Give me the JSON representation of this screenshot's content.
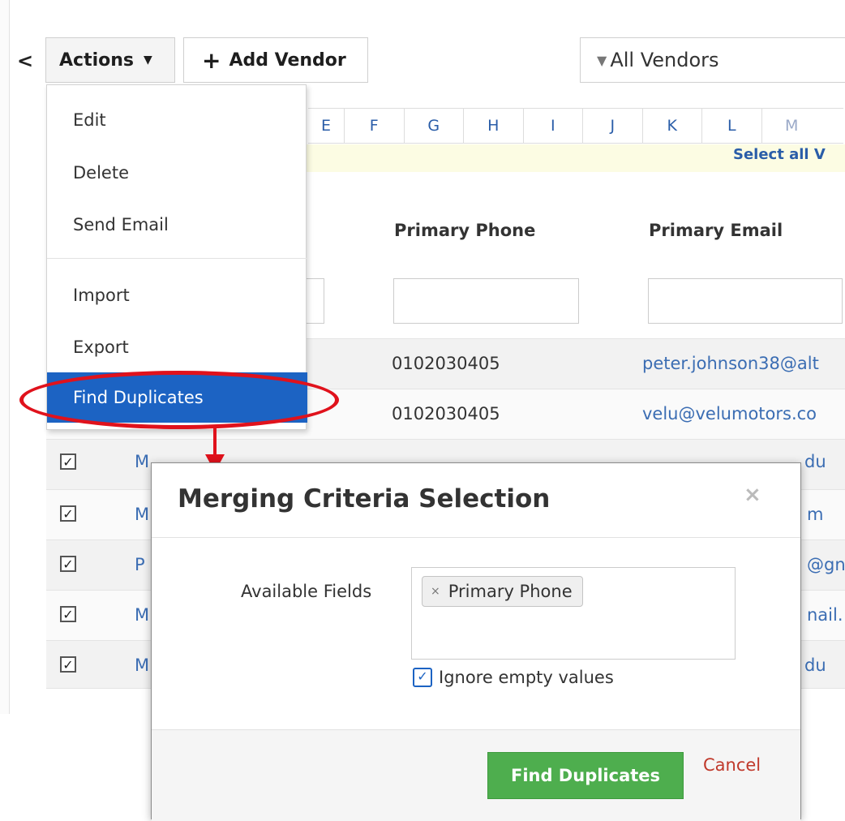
{
  "toolbar": {
    "collapse_glyph": "<",
    "actions_label": "Actions",
    "caret_glyph": "▼",
    "add_vendor_plus": "+",
    "add_vendor_label": "Add Vendor",
    "filter_icon": "▼",
    "filter_value": "All Vendors"
  },
  "alphabet": [
    "E",
    "F",
    "G",
    "H",
    "I",
    "J",
    "K",
    "L",
    "M"
  ],
  "select_all_text": "Select all V",
  "table": {
    "columns": [
      "Primary Phone",
      "Primary Email"
    ],
    "rows": [
      {
        "checked": false,
        "name": "",
        "phone": "0102030405",
        "email": "peter.johnson38@alt"
      },
      {
        "checked": false,
        "name": "",
        "phone": "0102030405",
        "email": "velu@velumotors.co"
      },
      {
        "checked": true,
        "name": "M",
        "phone": "",
        "email": "du"
      },
      {
        "checked": true,
        "name": "M",
        "phone": "",
        "email": "m"
      },
      {
        "checked": true,
        "name": "P",
        "phone": "",
        "email": "@gn"
      },
      {
        "checked": true,
        "name": "M",
        "phone": "",
        "email": "nail."
      },
      {
        "checked": true,
        "name": "M",
        "phone": "",
        "email": "du"
      }
    ],
    "check_glyph": "✓"
  },
  "actions_menu": {
    "items": [
      "Edit",
      "Delete",
      "Send Email",
      "Import",
      "Export",
      "Find Duplicates"
    ],
    "selected": "Find Duplicates"
  },
  "modal": {
    "title": "Merging Criteria Selection",
    "close_glyph": "×",
    "available_fields_label": "Available Fields",
    "selected_field_tag": "Primary Phone",
    "tag_remove_glyph": "×",
    "ignore_empty_label": "Ignore empty values",
    "ignore_empty_checked": true,
    "primary_button": "Find Duplicates",
    "cancel_link": "Cancel"
  },
  "colors": {
    "menu_highlight": "#1c63c3",
    "annotation_red": "#e0121c",
    "primary_green": "#4eae4e",
    "cancel_red": "#c0392b"
  }
}
